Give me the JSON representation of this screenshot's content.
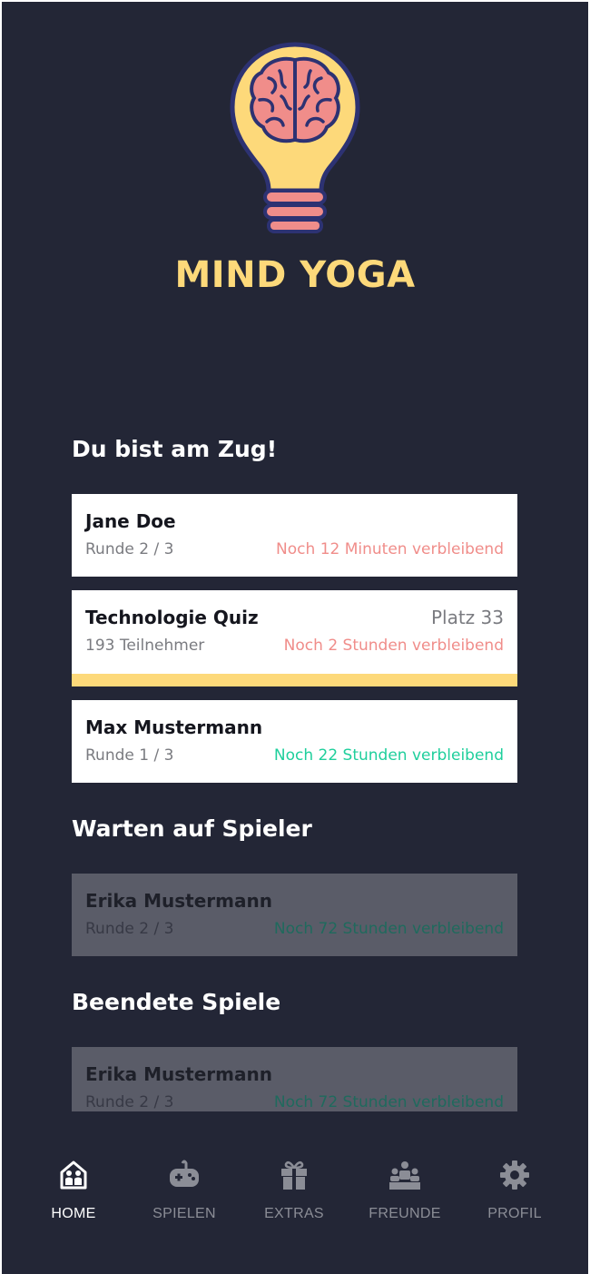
{
  "app": {
    "title": "MIND YOGA",
    "logo_icon": "brain-lightbulb-icon",
    "colors": {
      "background": "#232636",
      "accent": "#fdd97a",
      "urgent": "#f08d8a",
      "ok": "#1fcf9c"
    }
  },
  "sections": {
    "your_turn": "Du bist am Zug!",
    "waiting": "Warten auf Spieler",
    "finished": "Beendete Spiele"
  },
  "your_turn_games": [
    {
      "name": "Jane Doe",
      "sub": "Runde 2 / 3",
      "remaining": "Noch 12 Minuten verbleibend"
    },
    {
      "name": "Technologie Quiz",
      "rank": "Platz 33",
      "sub": "193 Teilnehmer",
      "remaining": "Noch 2 Stunden verbleibend"
    },
    {
      "name": "Max Mustermann",
      "sub": "Runde 1 / 3",
      "remaining": "Noch 22 Stunden verbleibend"
    }
  ],
  "waiting_games": [
    {
      "name": "Erika Mustermann",
      "sub": "Runde 2 / 3",
      "remaining": "Noch 72 Stunden verbleibend"
    }
  ],
  "finished_games": [
    {
      "name": "Erika Mustermann",
      "sub": "Runde 2 / 3",
      "remaining": "Noch 72 Stunden verbleibend"
    }
  ],
  "nav": [
    {
      "label": "HOME",
      "icon": "home-family-icon",
      "active": true
    },
    {
      "label": "SPIELEN",
      "icon": "gamepad-icon",
      "active": false
    },
    {
      "label": "EXTRAS",
      "icon": "gift-icon",
      "active": false
    },
    {
      "label": "FREUNDE",
      "icon": "podium-friends-icon",
      "active": false
    },
    {
      "label": "PROFIL",
      "icon": "gear-icon",
      "active": false
    }
  ]
}
